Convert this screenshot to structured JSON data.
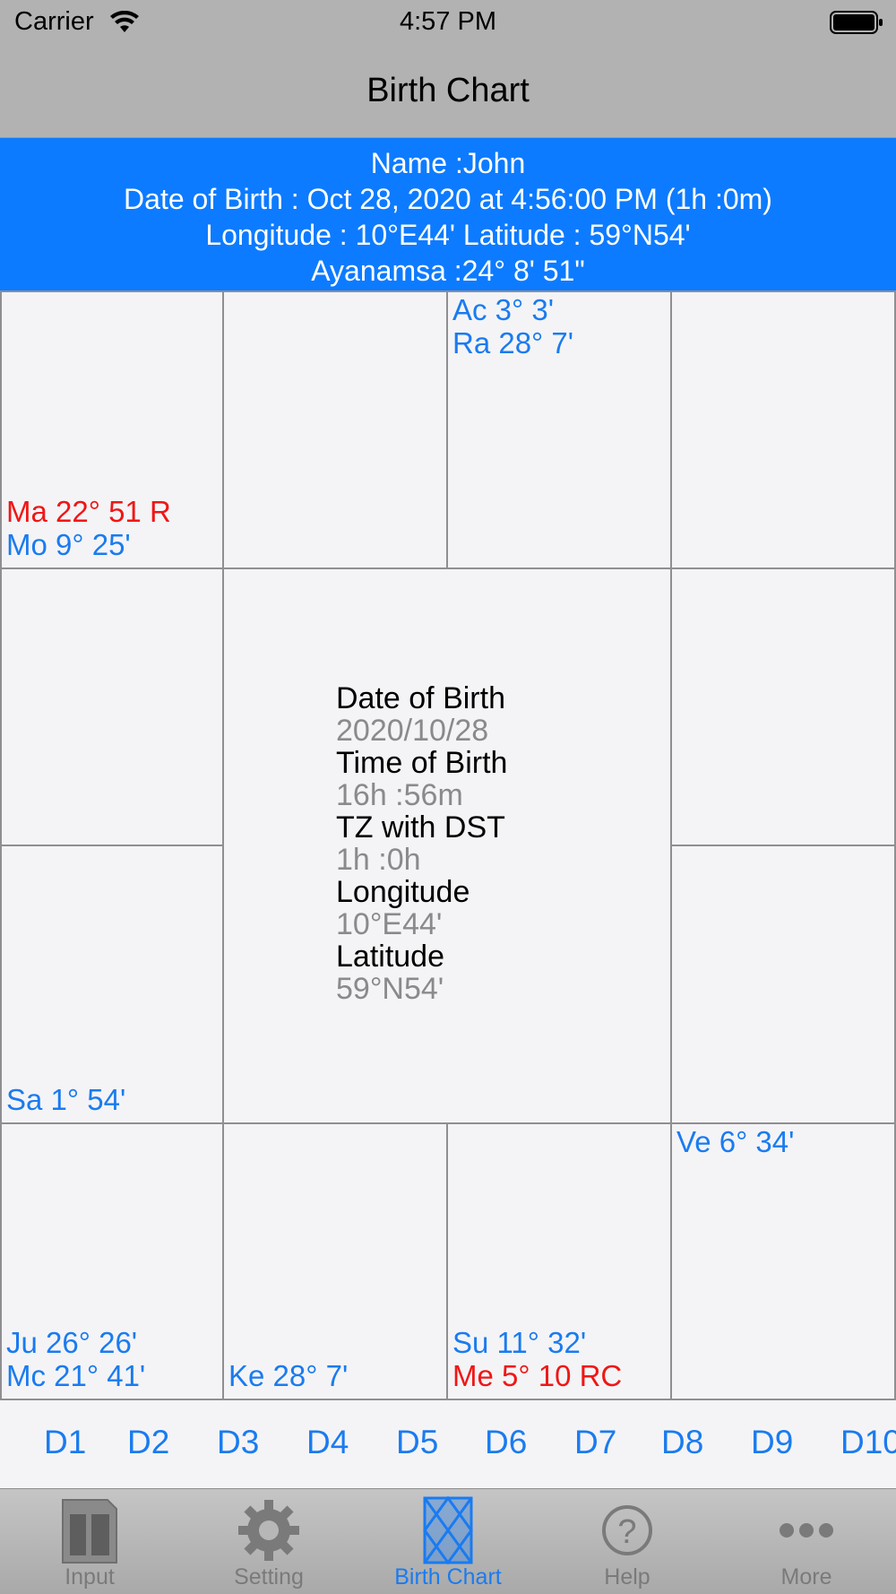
{
  "status_bar": {
    "carrier": "Carrier",
    "time": "4:57 PM"
  },
  "nav": {
    "title": "Birth Chart"
  },
  "banner": {
    "name_line": "Name :John",
    "dob_line": "Date of Birth : Oct 28, 2020 at 4:56:00 PM (1h :0m)",
    "location_line": "Longitude : 10°E44' Latitude : 59°N54'",
    "ayanamsa_line": "Ayanamsa :24° 8' 51\""
  },
  "chart": {
    "c1": [
      "Ma 22° 51 R",
      "Mo 9° 25'"
    ],
    "c3": [
      "Ac 3° 3'",
      "Ra 28° 7'"
    ],
    "c6": [
      "Sa 1° 54'"
    ],
    "c8": [
      "Ve 6° 34'"
    ],
    "c9": [
      "Ju 26° 26'",
      "Mc 21° 41'"
    ],
    "c10": [
      "Ke 28° 7'"
    ],
    "c11": [
      "Su 11° 32'",
      "Me 5° 10 RC"
    ]
  },
  "center": {
    "dob_label": "Date of Birth",
    "dob_value": "2020/10/28",
    "tob_label": "Time of Birth",
    "tob_value": "16h :56m",
    "tz_label": "TZ with DST",
    "tz_value": "1h :0h",
    "lon_label": "Longitude",
    "lon_value": "10°E44'",
    "lat_label": "Latitude",
    "lat_value": "59°N54'"
  },
  "divisions": [
    "D1",
    "D2",
    "D3",
    "D4",
    "D5",
    "D6",
    "D7",
    "D8",
    "D9",
    "D10"
  ],
  "tabs": [
    {
      "label": "Input",
      "icon": "input-icon"
    },
    {
      "label": "Setting",
      "icon": "gear-icon"
    },
    {
      "label": "Birth Chart",
      "icon": "chart-grid-icon",
      "active": true
    },
    {
      "label": "Help",
      "icon": "help-icon"
    },
    {
      "label": "More",
      "icon": "more-icon"
    }
  ],
  "colors": {
    "accent": "#1a7bf0",
    "banner": "#0d7bff",
    "retrograde": "#f01616"
  }
}
